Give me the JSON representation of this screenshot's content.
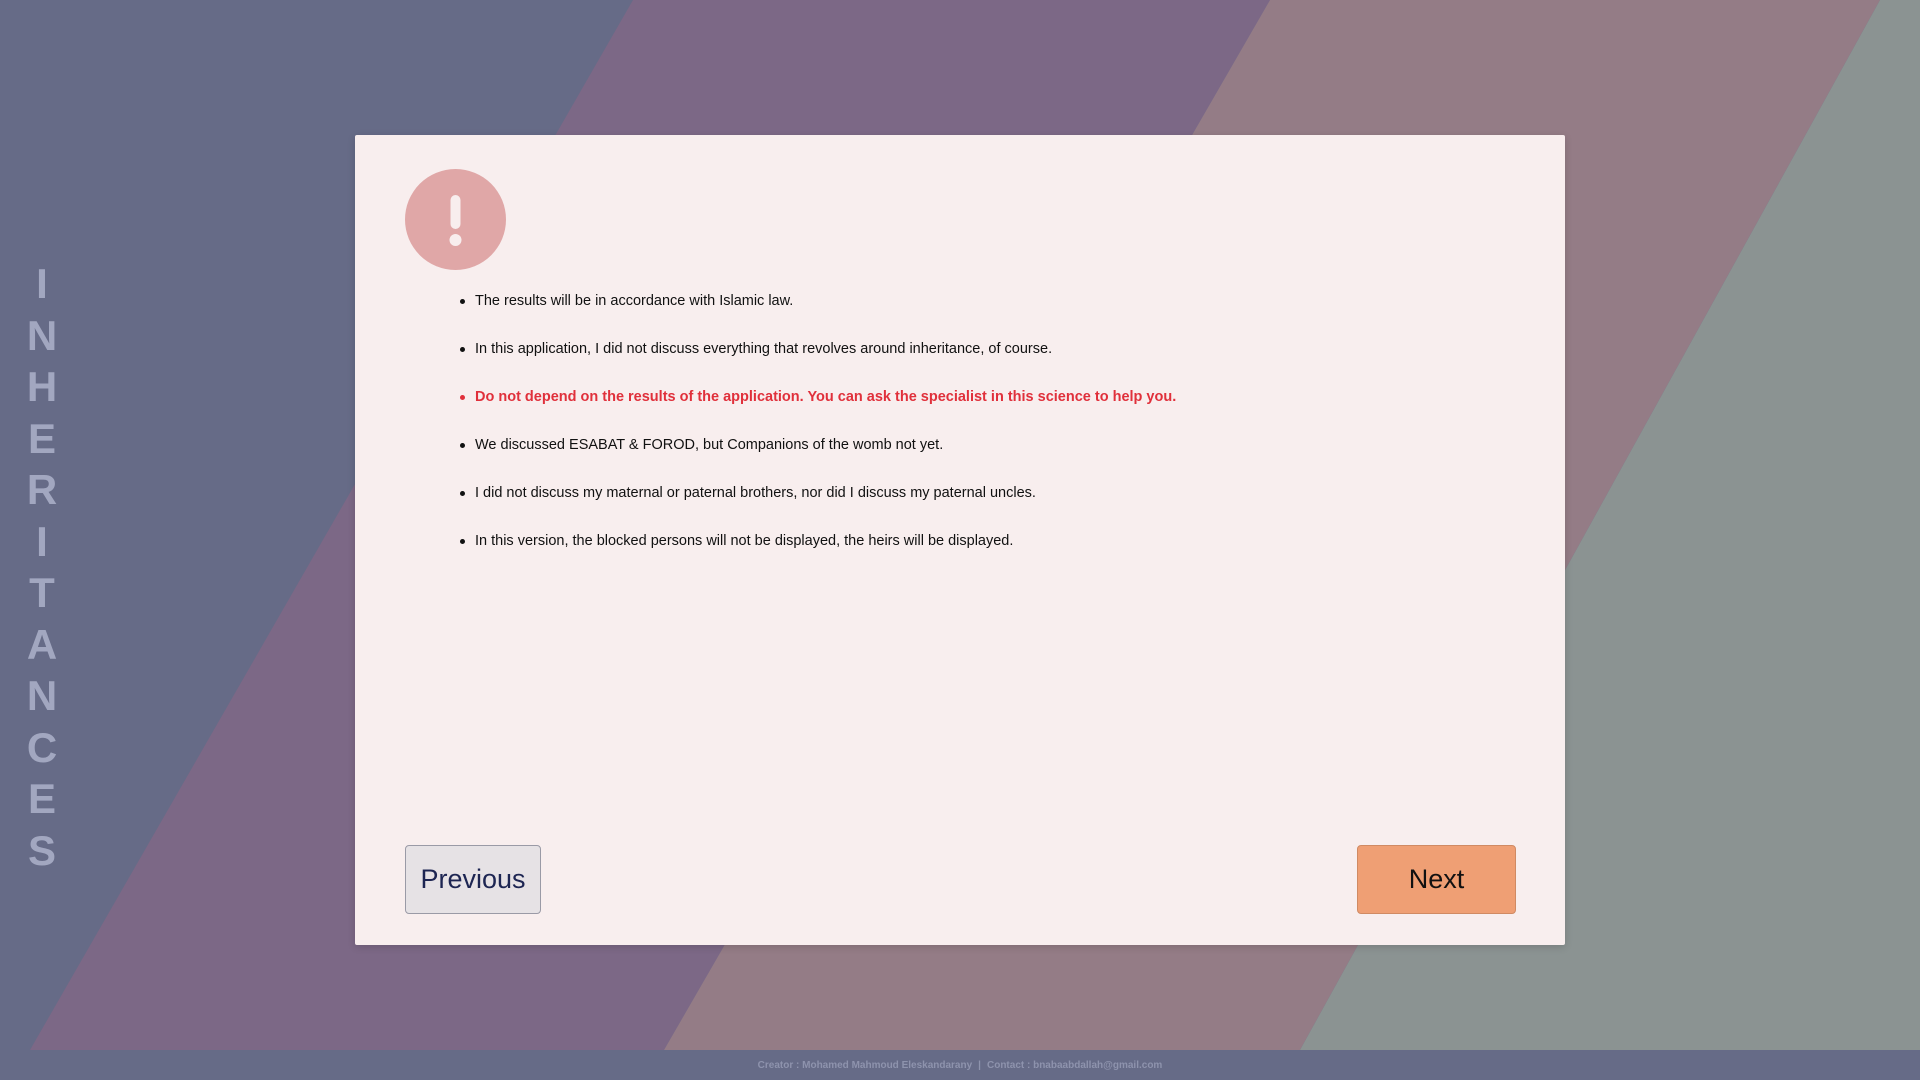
{
  "sidebar": {
    "title_letters": [
      "I",
      "N",
      "H",
      "E",
      "R",
      "I",
      "T",
      "A",
      "N",
      "C",
      "E",
      "S"
    ]
  },
  "alert": {
    "icon": "exclamation-icon",
    "color": "#e0a7a7"
  },
  "notes": [
    {
      "text": "The results will be in accordance with Islamic law.",
      "warning": false
    },
    {
      "text": "In this application, I did not discuss everything that revolves around inheritance, of course.",
      "warning": false
    },
    {
      "text": "Do not depend on the results of the application. You can ask the specialist in this science to help you.",
      "warning": true
    },
    {
      "text": "We discussed ESABAT & FOROD, but Companions of the womb not yet.",
      "warning": false
    },
    {
      "text": "I did not discuss my maternal or paternal brothers, nor did I discuss my paternal uncles.",
      "warning": false
    },
    {
      "text": "In this version, the blocked persons will not be displayed, the heirs will be displayed.",
      "warning": false
    }
  ],
  "buttons": {
    "previous_label": "Previous",
    "next_label": "Next"
  },
  "footer": {
    "creator": "Creator : Mohamed Mahmoud Eleskandarany",
    "separator": "|",
    "contact": "Contact : bnabaabdallah@gmail.com"
  },
  "colors": {
    "background": "#666b87",
    "card": "#f8eeee",
    "warning_text": "#e0303b",
    "next_button": "#ef9f74",
    "previous_button": "#e6e2e5"
  }
}
